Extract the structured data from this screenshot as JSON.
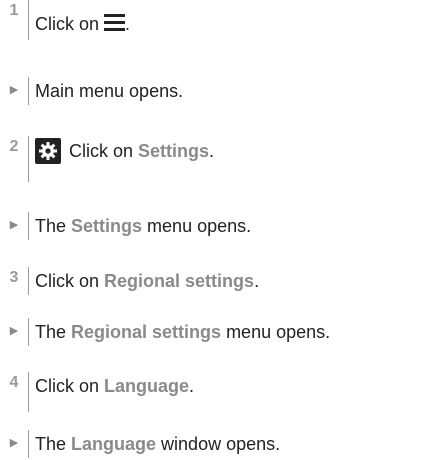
{
  "steps": [
    {
      "number": "1",
      "before": "Click on",
      "after": "."
    },
    {
      "number": "2",
      "before": "Click on",
      "highlight": "Settings",
      "after": "."
    },
    {
      "number": "3",
      "before": "Click on",
      "highlight": "Regional settings",
      "after": "."
    },
    {
      "number": "4",
      "before": "Click on",
      "highlight": "Language",
      "after": "."
    }
  ],
  "results": [
    {
      "marker": "▶",
      "text": "Main menu opens."
    },
    {
      "marker": "▶",
      "before": "The",
      "highlight": "Settings",
      "after": "menu opens."
    },
    {
      "marker": "▶",
      "before": "The",
      "highlight": "Regional settings",
      "after": "menu opens."
    },
    {
      "marker": "▶",
      "before": "The",
      "highlight": "Language",
      "after": "window opens."
    }
  ],
  "icons": {
    "menu": "hamburger-menu-icon",
    "settings": "gear-icon"
  },
  "colors": {
    "highlight": "#8a8a8a",
    "text": "#222222",
    "marker": "#9a9a9a"
  }
}
